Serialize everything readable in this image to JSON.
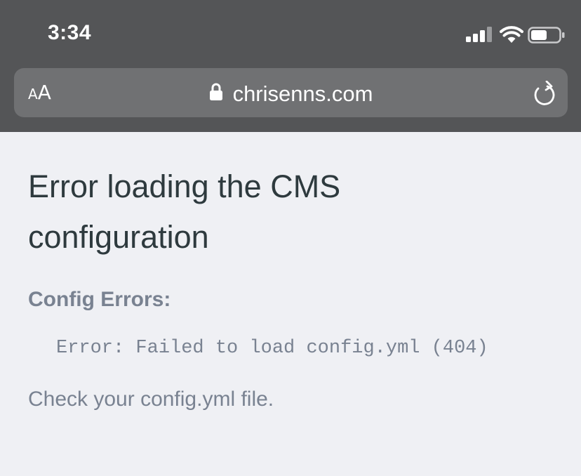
{
  "status_bar": {
    "time": "3:34"
  },
  "address_bar": {
    "text_size_small": "A",
    "text_size_large": "A",
    "url": "chrisenns.com"
  },
  "page": {
    "title": "Error loading the CMS configuration",
    "errors_heading": "Config Errors:",
    "error_message": "Error: Failed to load config.yml (404)",
    "help_text": "Check your config.yml file."
  },
  "colors": {
    "chrome_background": "#545557",
    "address_bar_background": "#707173",
    "page_background": "#eff0f4",
    "title_text": "#2e3a3e",
    "muted_text": "#798291"
  }
}
